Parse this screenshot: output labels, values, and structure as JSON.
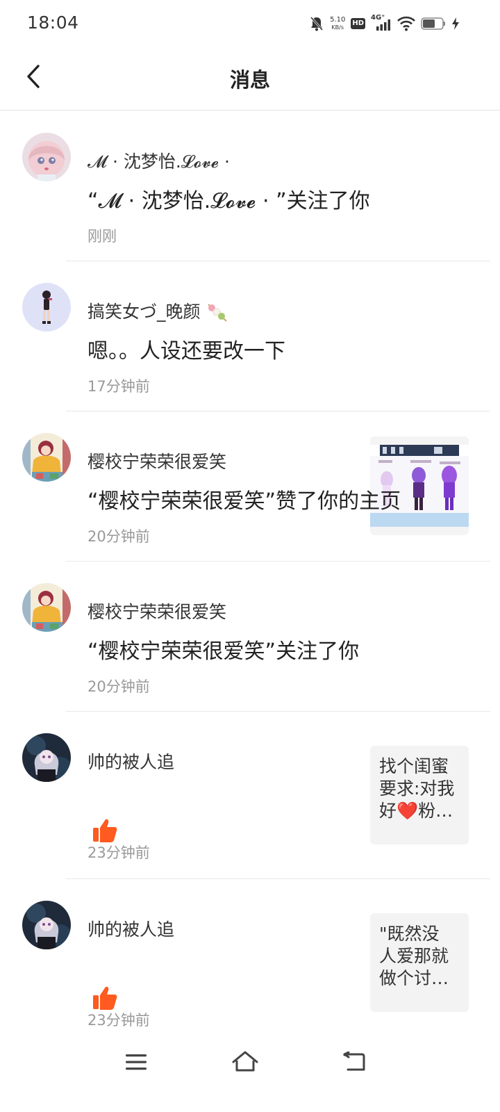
{
  "status_bar": {
    "time": "18:04",
    "net_speed_value": "5.10",
    "net_speed_unit": "KB/s",
    "hd_label": "HD",
    "signal_label": "4G⁺",
    "icons": [
      "mute-bell-icon",
      "hd-icon",
      "signal-4g-icon",
      "wifi-icon",
      "battery-icon",
      "charging-icon"
    ]
  },
  "header": {
    "title": "消息",
    "back_icon": "chevron-left-icon"
  },
  "messages": [
    {
      "username": "𝓜 · 沈梦怡.𝓛𝓸𝓿𝓮 ·",
      "text": "“𝓜 · 沈梦怡.𝓛𝓸𝓿𝓮 · ”关注了你",
      "time": "刚刚"
    },
    {
      "username": "搞笑女づ_晚颜",
      "text": "嗯。。人设还要改一下",
      "time": "17分钟前",
      "thumbnail": "image"
    },
    {
      "username": "樱校宁荣荣很爱笑",
      "text": "“樱校宁荣荣很爱笑”赞了你的主页",
      "time": "20分钟前"
    },
    {
      "username": "樱校宁荣荣很爱笑",
      "text": "“樱校宁荣荣很爱笑”关注了你",
      "time": "20分钟前"
    },
    {
      "username": "帅的被人追",
      "icon": "thumbs-up-icon",
      "time": "23分钟前",
      "preview_lines": [
        "找个闺蜜",
        "要求:对我",
        "好❤️粉…"
      ]
    },
    {
      "username": "帅的被人追",
      "icon": "thumbs-up-icon",
      "time": "23分钟前",
      "preview_lines": [
        "\"既然没",
        "人爱那就",
        "做个讨…"
      ]
    }
  ],
  "nav_bar": {
    "icons": [
      "menu-icon",
      "home-icon",
      "back-return-icon"
    ]
  },
  "colors": {
    "like_orange": "#ff5a1f",
    "time_gray": "#999999",
    "divider": "#e8e8e8"
  }
}
